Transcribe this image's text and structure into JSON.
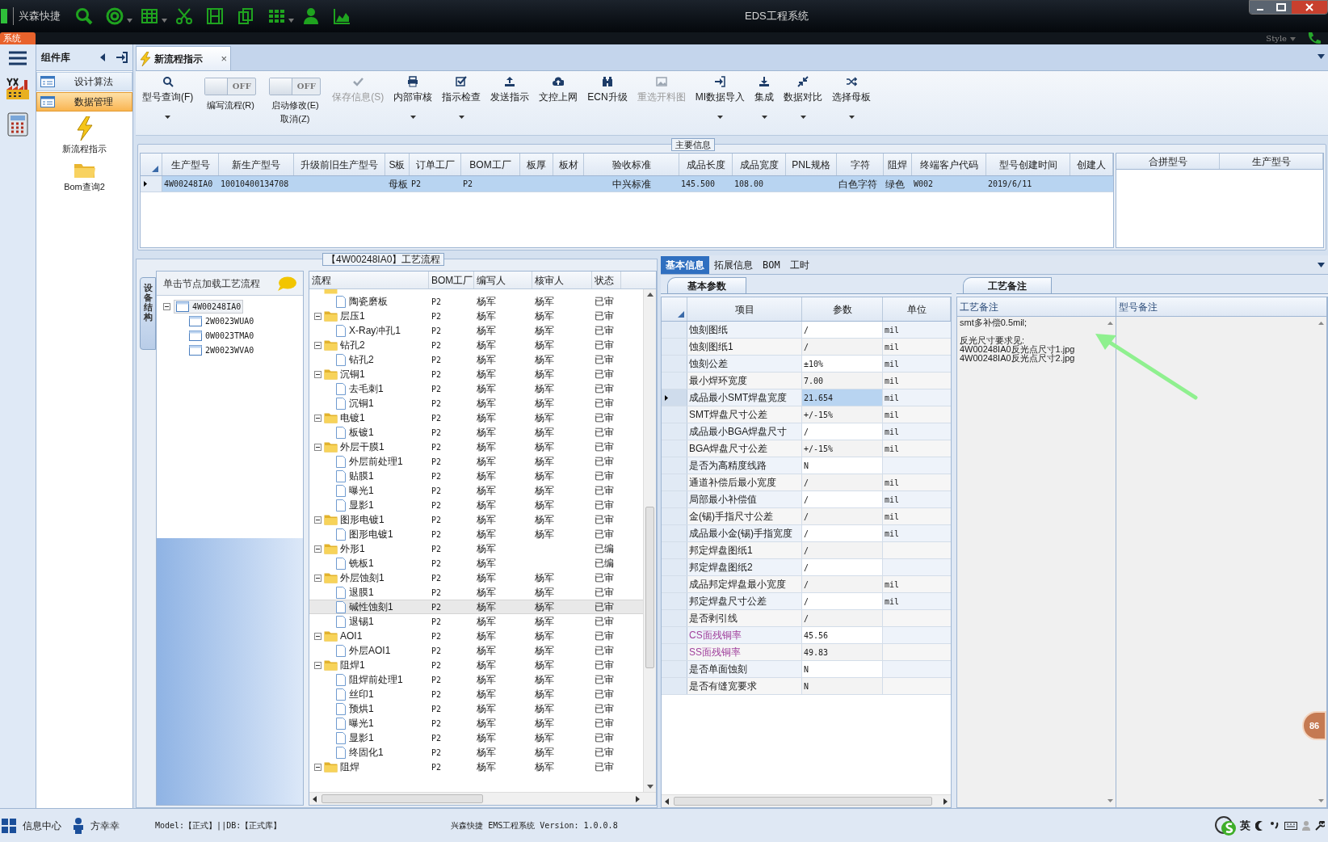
{
  "window": {
    "app_name": "兴森快捷",
    "title": "EDS工程系统",
    "menu_tab": "系统",
    "style_label": "Style"
  },
  "sidebar": {
    "title": "组件库",
    "items": [
      {
        "label": "设计算法",
        "selected": false
      },
      {
        "label": "数据管理",
        "selected": true
      }
    ],
    "shortcuts": [
      {
        "label": "新流程指示"
      },
      {
        "label": "Bom查询2"
      }
    ]
  },
  "document_tab": {
    "label": "新流程指示",
    "close": "×"
  },
  "toolbar": [
    {
      "kind": "button",
      "label": "型号查询(F)",
      "dropdown": true,
      "disabled": false
    },
    {
      "kind": "toggle",
      "label": "编写流程(R)",
      "on": false,
      "state_text": "OFF"
    },
    {
      "kind": "toggle",
      "label": "启动修改(E)",
      "sub_label": "取消(Z)",
      "on": false,
      "state_text": "OFF"
    },
    {
      "kind": "button",
      "label": "保存信息(S)",
      "dropdown": false,
      "disabled": true
    },
    {
      "kind": "button",
      "label": "内部审核",
      "dropdown": true,
      "disabled": false
    },
    {
      "kind": "button",
      "label": "指示检查",
      "dropdown": true,
      "disabled": false
    },
    {
      "kind": "button",
      "label": "发送指示",
      "dropdown": false,
      "disabled": false
    },
    {
      "kind": "button",
      "label": "文控上网",
      "dropdown": false,
      "disabled": false
    },
    {
      "kind": "button",
      "label": "ECN升级",
      "dropdown": false,
      "disabled": false
    },
    {
      "kind": "button",
      "label": "重选开料图",
      "dropdown": false,
      "disabled": true
    },
    {
      "kind": "button",
      "label": "MI数据导入",
      "dropdown": true,
      "disabled": false
    },
    {
      "kind": "button",
      "label": "集成",
      "dropdown": true,
      "disabled": false
    },
    {
      "kind": "button",
      "label": "数据对比",
      "dropdown": true,
      "disabled": false
    },
    {
      "kind": "button",
      "label": "选择母板",
      "dropdown": true,
      "disabled": false
    }
  ],
  "main_info": {
    "title": "主要信息",
    "columns": [
      "生产型号",
      "新生产型号",
      "升级前旧生产型号",
      "S板",
      "订单工厂",
      "BOM工厂",
      "板厚",
      "板材",
      "验收标准",
      "成品长度",
      "成品宽度",
      "PNL规格",
      "字符",
      "阻焊",
      "终端客户代码",
      "型号创建时间",
      "创建人"
    ],
    "rows": [
      {
        "selected": true,
        "cells": [
          "4W00248IA0",
          "10010400134708",
          null,
          "母板",
          "P2",
          "P2",
          null,
          null,
          "中兴标准",
          "145.500",
          "108.00",
          null,
          "白色字符",
          "绿色",
          "W002",
          "2019/6/11",
          null
        ]
      }
    ],
    "side_columns": [
      "合拼型号",
      "生产型号"
    ]
  },
  "structure": {
    "side_tab": "设备结构",
    "hint": "单击节点加载工艺流程",
    "tree": [
      {
        "label": "4W00248IA0",
        "expanded": true,
        "selected": true,
        "children": [
          {
            "label": "2W0023WUA0",
            "selected": false
          },
          {
            "label": "0W0023TMA0",
            "selected": false
          },
          {
            "label": "2W0023WVA0",
            "selected": false
          }
        ]
      }
    ]
  },
  "flow": {
    "title": "【4W00248IA0】工艺流程",
    "columns": [
      "流程",
      "BOM工厂",
      "编写人",
      "核审人",
      "状态"
    ],
    "rows": [
      {
        "kind": "folder",
        "children": [
          {
            "kind": "step",
            "name": "陶瓷磨板",
            "bom": "P2",
            "writer": "杨军",
            "reviewer": "杨军",
            "status": "已审",
            "selected": false
          }
        ]
      },
      {
        "kind": "folder",
        "name": "层压1",
        "bom": "P2",
        "writer": "杨军",
        "reviewer": "杨军",
        "status": "已审",
        "expanded": true,
        "selected": false,
        "children": [
          {
            "kind": "step",
            "name": "X-Ray冲孔1",
            "bom": "P2",
            "writer": "杨军",
            "reviewer": "杨军",
            "status": "已审",
            "selected": false
          }
        ]
      },
      {
        "kind": "folder",
        "name": "钻孔2",
        "bom": "P2",
        "writer": "杨军",
        "reviewer": "杨军",
        "status": "已审",
        "expanded": true,
        "selected": false,
        "children": [
          {
            "kind": "step",
            "name": "钻孔2",
            "bom": "P2",
            "writer": "杨军",
            "reviewer": "杨军",
            "status": "已审",
            "selected": false
          }
        ]
      },
      {
        "kind": "folder",
        "name": "沉铜1",
        "bom": "P2",
        "writer": "杨军",
        "reviewer": "杨军",
        "status": "已审",
        "expanded": true,
        "selected": false,
        "children": [
          {
            "kind": "step",
            "name": "去毛刺1",
            "bom": "P2",
            "writer": "杨军",
            "reviewer": "杨军",
            "status": "已审",
            "selected": false
          },
          {
            "kind": "step",
            "name": "沉铜1",
            "bom": "P2",
            "writer": "杨军",
            "reviewer": "杨军",
            "status": "已审",
            "selected": false
          }
        ]
      },
      {
        "kind": "folder",
        "name": "电镀1",
        "bom": "P2",
        "writer": "杨军",
        "reviewer": "杨军",
        "status": "已审",
        "expanded": true,
        "selected": false,
        "children": [
          {
            "kind": "step",
            "name": "板镀1",
            "bom": "P2",
            "writer": "杨军",
            "reviewer": "杨军",
            "status": "已审",
            "selected": false
          }
        ]
      },
      {
        "kind": "folder",
        "name": "外层干膜1",
        "bom": "P2",
        "writer": "杨军",
        "reviewer": "杨军",
        "status": "已审",
        "expanded": true,
        "selected": false,
        "children": [
          {
            "kind": "step",
            "name": "外层前处理1",
            "bom": "P2",
            "writer": "杨军",
            "reviewer": "杨军",
            "status": "已审",
            "selected": false
          },
          {
            "kind": "step",
            "name": "贴膜1",
            "bom": "P2",
            "writer": "杨军",
            "reviewer": "杨军",
            "status": "已审",
            "selected": false
          },
          {
            "kind": "step",
            "name": "曝光1",
            "bom": "P2",
            "writer": "杨军",
            "reviewer": "杨军",
            "status": "已审",
            "selected": false
          },
          {
            "kind": "step",
            "name": "显影1",
            "bom": "P2",
            "writer": "杨军",
            "reviewer": "杨军",
            "status": "已审",
            "selected": false
          }
        ]
      },
      {
        "kind": "folder",
        "name": "图形电镀1",
        "bom": "P2",
        "writer": "杨军",
        "reviewer": "杨军",
        "status": "已审",
        "expanded": true,
        "selected": false,
        "children": [
          {
            "kind": "step",
            "name": "图形电镀1",
            "bom": "P2",
            "writer": "杨军",
            "reviewer": "杨军",
            "status": "已审",
            "selected": false
          }
        ]
      },
      {
        "kind": "folder",
        "name": "外形1",
        "bom": "P2",
        "writer": "杨军",
        "status": "已编",
        "expanded": true,
        "selected": false,
        "children": [
          {
            "kind": "step",
            "name": "铣板1",
            "bom": "P2",
            "writer": "杨军",
            "status": "已编",
            "selected": false
          }
        ]
      },
      {
        "kind": "folder",
        "name": "外层蚀刻1",
        "bom": "P2",
        "writer": "杨军",
        "reviewer": "杨军",
        "status": "已审",
        "expanded": true,
        "selected": false,
        "children": [
          {
            "kind": "step",
            "name": "退膜1",
            "bom": "P2",
            "writer": "杨军",
            "reviewer": "杨军",
            "status": "已审",
            "selected": false
          },
          {
            "kind": "step",
            "name": "碱性蚀刻1",
            "bom": "P2",
            "writer": "杨军",
            "reviewer": "杨军",
            "status": "已审",
            "selected": true
          },
          {
            "kind": "step",
            "name": "退锡1",
            "bom": "P2",
            "writer": "杨军",
            "reviewer": "杨军",
            "status": "已审",
            "selected": false
          }
        ]
      },
      {
        "kind": "folder",
        "name": "AOI1",
        "bom": "P2",
        "writer": "杨军",
        "reviewer": "杨军",
        "status": "已审",
        "expanded": true,
        "selected": false,
        "children": [
          {
            "kind": "step",
            "name": "外层AOI1",
            "bom": "P2",
            "writer": "杨军",
            "reviewer": "杨军",
            "status": "已审",
            "selected": false
          }
        ]
      },
      {
        "kind": "folder",
        "name": "阻焊1",
        "bom": "P2",
        "writer": "杨军",
        "reviewer": "杨军",
        "status": "已审",
        "expanded": true,
        "selected": false,
        "children": [
          {
            "kind": "step",
            "name": "阻焊前处理1",
            "bom": "P2",
            "writer": "杨军",
            "reviewer": "杨军",
            "status": "已审",
            "selected": false
          },
          {
            "kind": "step",
            "name": "丝印1",
            "bom": "P2",
            "writer": "杨军",
            "reviewer": "杨军",
            "status": "已审",
            "selected": false
          },
          {
            "kind": "step",
            "name": "预烘1",
            "bom": "P2",
            "writer": "杨军",
            "reviewer": "杨军",
            "status": "已审",
            "selected": false
          },
          {
            "kind": "step",
            "name": "曝光1",
            "bom": "P2",
            "writer": "杨军",
            "reviewer": "杨军",
            "status": "已审",
            "selected": false
          },
          {
            "kind": "step",
            "name": "显影1",
            "bom": "P2",
            "writer": "杨军",
            "reviewer": "杨军",
            "status": "已审",
            "selected": false
          },
          {
            "kind": "step",
            "name": "终固化1",
            "bom": "P2",
            "writer": "杨军",
            "reviewer": "杨军",
            "status": "已审",
            "selected": false
          }
        ]
      },
      {
        "kind": "folder",
        "name": "阻焊",
        "bom": "P2",
        "writer": "杨军",
        "reviewer": "杨军",
        "status": "已审",
        "expanded": true,
        "selected": false
      }
    ]
  },
  "detail": {
    "tabs": [
      {
        "label": "基本信息",
        "selected": true
      },
      {
        "label": "拓展信息",
        "selected": false
      },
      {
        "label": "BOM",
        "selected": false
      },
      {
        "label": "工时",
        "selected": false
      }
    ],
    "params": {
      "tab": "基本参数",
      "columns": [
        "项目",
        "参数",
        "单位"
      ],
      "rows": [
        {
          "item": "蚀刻图纸",
          "value": "/",
          "unit": "mil",
          "selected": false
        },
        {
          "item": "蚀刻图纸1",
          "value": "/",
          "unit": "mil",
          "selected": false
        },
        {
          "item": "蚀刻公差",
          "value": "±10%",
          "unit": "mil",
          "selected": false
        },
        {
          "item": "最小焊环宽度",
          "value": "7.00",
          "unit": "mil",
          "selected": false
        },
        {
          "item": "成品最小SMT焊盘宽度",
          "value": "21.654",
          "unit": "mil",
          "selected": true
        },
        {
          "item": "SMT焊盘尺寸公差",
          "value": "+/-15%",
          "unit": "mil",
          "selected": false
        },
        {
          "item": "成品最小BGA焊盘尺寸",
          "value": "/",
          "unit": "mil",
          "selected": false
        },
        {
          "item": "BGA焊盘尺寸公差",
          "value": "+/-15%",
          "unit": "mil",
          "selected": false
        },
        {
          "item": "是否为高精度线路",
          "value": "N",
          "selected": false
        },
        {
          "item": "通道补偿后最小宽度",
          "value": "/",
          "unit": "mil",
          "selected": false
        },
        {
          "item": "局部最小补偿值",
          "value": "/",
          "unit": "mil",
          "selected": false
        },
        {
          "item": "金(锡)手指尺寸公差",
          "value": "/",
          "unit": "mil",
          "selected": false
        },
        {
          "item": "成品最小金(锡)手指宽度",
          "value": "/",
          "unit": "mil",
          "selected": false
        },
        {
          "item": "邦定焊盘图纸1",
          "value": "/",
          "selected": false
        },
        {
          "item": "邦定焊盘图纸2",
          "value": "/",
          "selected": false
        },
        {
          "item": "成品邦定焊盘最小宽度",
          "value": "/",
          "unit": "mil",
          "selected": false
        },
        {
          "item": "邦定焊盘尺寸公差",
          "value": "/",
          "unit": "mil",
          "selected": false
        },
        {
          "item": "是否剥引线",
          "value": "/",
          "selected": false
        },
        {
          "item": "CS面残铜率",
          "value": "45.56",
          "color": "#a0409c",
          "selected": false
        },
        {
          "item": "SS面残铜率",
          "value": "49.83",
          "color": "#a0409c",
          "selected": false
        },
        {
          "item": "是否单面蚀刻",
          "value": "N",
          "selected": false
        },
        {
          "item": "是否有缝宽要求",
          "value": "N",
          "selected": false
        }
      ]
    },
    "notes": {
      "tab": "工艺备注",
      "columns": [
        "工艺备注",
        "型号备注"
      ],
      "process_note": [
        [
          "smt多补偿0.5mil;"
        ],
        [
          "反光尺寸要求见:",
          "4W00248IA0反光点尺寸1.jpg",
          "4W00248IA0反光点尺寸2.jpg"
        ]
      ]
    }
  },
  "badge": "86",
  "status_bar": {
    "info_center": "信息中心",
    "user": "方幸幸",
    "model_db": "Model:【正式】||DB:【正式库】",
    "version": "兴森快捷 EMS工程系统 Version: 1.0.0.8",
    "ime": "英"
  }
}
